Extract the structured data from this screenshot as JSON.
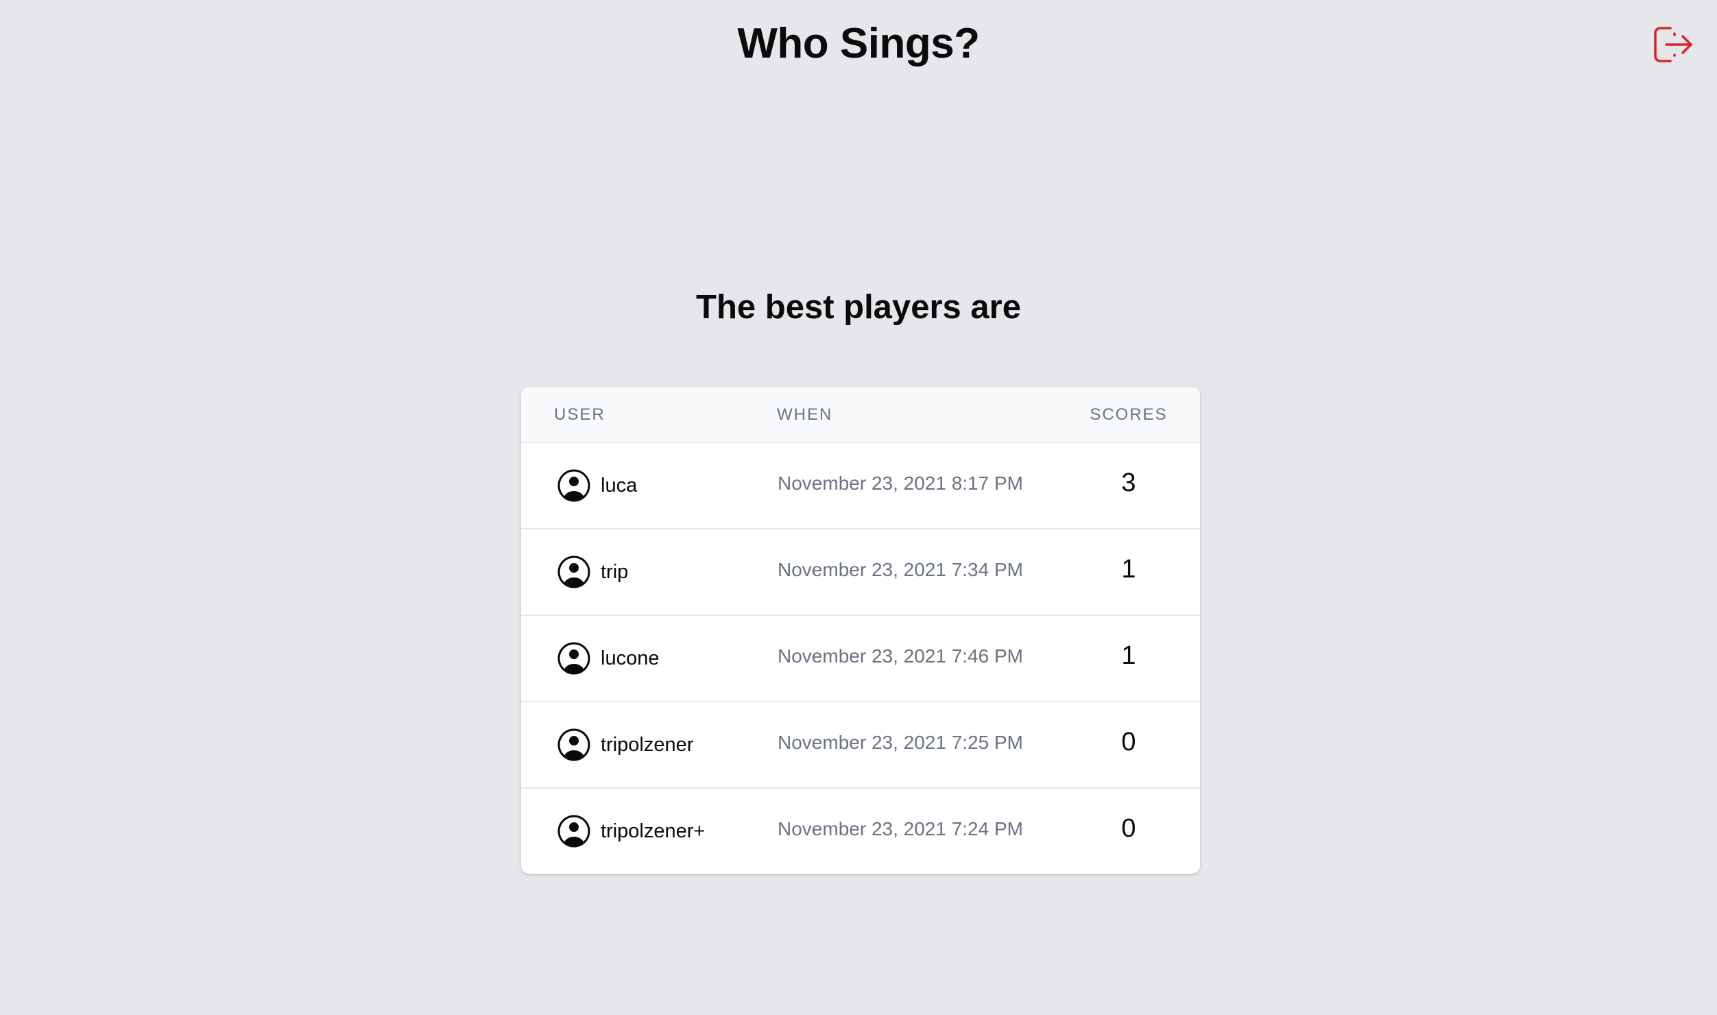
{
  "header": {
    "title": "Who Sings?",
    "logout_icon": "logout-icon",
    "logout_color": "#dc2626"
  },
  "leaderboard": {
    "title": "The best players are",
    "columns": {
      "user": "USER",
      "when": "WHEN",
      "scores": "SCORES"
    },
    "rows": [
      {
        "user": "luca",
        "when": "November 23, 2021 8:17 PM",
        "score": "3"
      },
      {
        "user": "trip",
        "when": "November 23, 2021 7:34 PM",
        "score": "1"
      },
      {
        "user": "lucone",
        "when": "November 23, 2021 7:46 PM",
        "score": "1"
      },
      {
        "user": "tripolzener",
        "when": "November 23, 2021 7:25 PM",
        "score": "0"
      },
      {
        "user": "tripolzener+",
        "when": "November 23, 2021 7:24 PM",
        "score": "0"
      }
    ],
    "avatar_icon": "user-circle-icon"
  }
}
